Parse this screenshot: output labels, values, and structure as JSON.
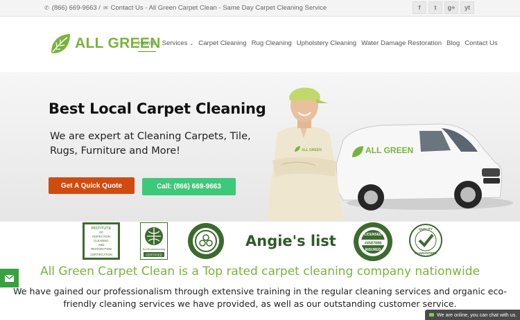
{
  "topbar": {
    "phone": "(866) 669-9663 /",
    "contact": "Contact Us - All Green Carpet Clean - Same Day Carpet Cleaning Service",
    "social": [
      "f",
      "t",
      "g+",
      "yt"
    ]
  },
  "header": {
    "logo_text": "ALL GREEN",
    "nav": {
      "home": "Home",
      "services": "Services",
      "carpet": "Carpet Cleaning",
      "rug": "Rug Cleaning",
      "upholstery": "Upholstery Cleaning",
      "water": "Water Damage Restoration",
      "blog": "Blog",
      "contact": "Contact Us"
    }
  },
  "hero": {
    "title": "Best Local Carpet Cleaning",
    "subtitle": "We are expert at Cleaning Carpets, Tile, Rugs, Furniture and More!",
    "quote_button": "Get A Quick Quote",
    "call_button": "Call: (866) 669-9663",
    "van_brand": "ALL GREEN",
    "cap_brand": "ALL GREEN"
  },
  "badges": {
    "iicrc": [
      "INSTITUTE",
      "OF",
      "INSPECTION",
      "CLEANING",
      "AND",
      "RESTORATION",
      "CERTIFICATION"
    ],
    "ecofriendly": [
      "EcoSmartcleaning",
      "CERTIFIED"
    ],
    "angies": "Angie's list",
    "licensed": [
      "LICENSED",
      "INSURED",
      "#4587888"
    ],
    "quality": [
      "QUALITY",
      "GUARANTEED"
    ]
  },
  "main": {
    "headline": "All Green Carpet Clean is a Top rated carpet cleaning company nationwide",
    "body": "We have gained our professionalism through extensive training in the regular cleaning services and organic eco-friendly cleaning services we have provided, as well as our outstanding customer service."
  },
  "chat": {
    "text": "We are online, you can chat with us."
  },
  "colors": {
    "brand_green": "#79b43a",
    "quote_orange": "#cf4b0f",
    "call_green": "#3ec87a",
    "badge_dark_green": "#2f5a2a"
  }
}
